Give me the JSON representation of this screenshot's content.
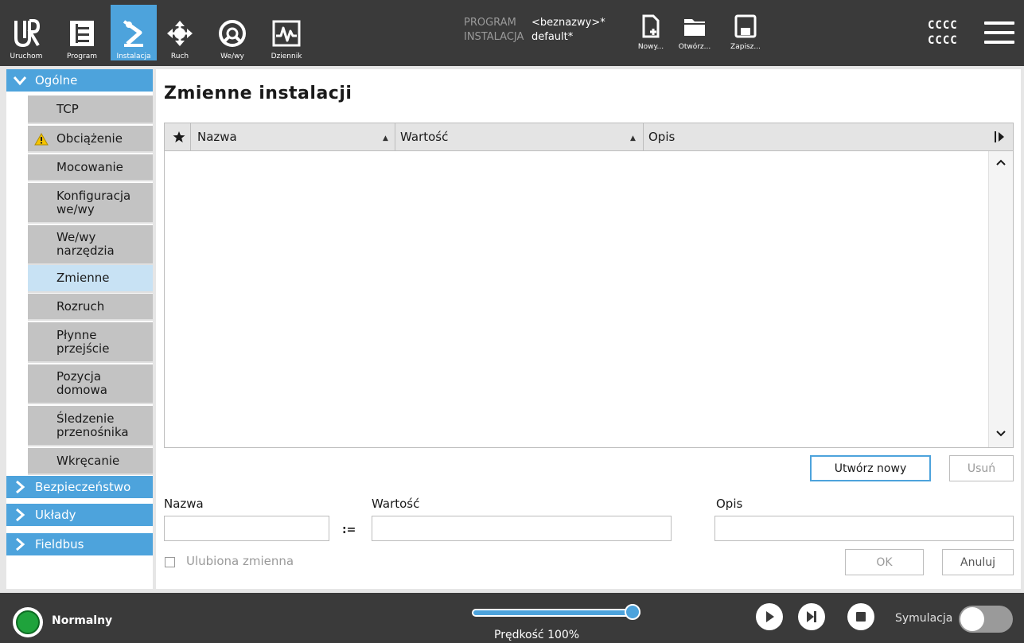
{
  "topbar": {
    "nav": [
      {
        "id": "run",
        "label": "Uruchom",
        "icon": "ur-logo-icon"
      },
      {
        "id": "program",
        "label": "Program",
        "icon": "program-tree-icon"
      },
      {
        "id": "installation",
        "label": "Instalacja",
        "icon": "robot-arm-icon",
        "active": true
      },
      {
        "id": "move",
        "label": "Ruch",
        "icon": "move-arrows-icon"
      },
      {
        "id": "io",
        "label": "We/wy",
        "icon": "io-icon"
      },
      {
        "id": "log",
        "label": "Dziennik",
        "icon": "log-chart-icon"
      }
    ],
    "program_key": "PROGRAM",
    "program_value": "<beznazwy>*",
    "installation_key": "INSTALACJA",
    "installation_value": "default*",
    "file_buttons": [
      {
        "id": "new",
        "label": "Nowy...",
        "icon": "new-file-icon"
      },
      {
        "id": "open",
        "label": "Otwórz...",
        "icon": "folder-icon"
      },
      {
        "id": "save",
        "label": "Zapisz...",
        "icon": "save-icon"
      }
    ],
    "user_line1": "CCCC",
    "user_line2": "CCCC",
    "menu_icon": "hamburger-menu-icon"
  },
  "sidebar": {
    "groups": [
      {
        "label": "Ogólne",
        "expanded": true
      },
      {
        "label": "Bezpieczeństwo",
        "expanded": false
      },
      {
        "label": "Układy",
        "expanded": false
      },
      {
        "label": "Fieldbus",
        "expanded": false
      }
    ],
    "items": [
      {
        "label": "TCP"
      },
      {
        "label": "Obciążenie",
        "warning": true
      },
      {
        "label": "Mocowanie"
      },
      {
        "label": "Konfiguracja we/wy"
      },
      {
        "label": "We/wy narzędzia"
      },
      {
        "label": "Zmienne",
        "selected": true
      },
      {
        "label": "Rozruch"
      },
      {
        "label": "Płynne przejście"
      },
      {
        "label": "Pozycja domowa"
      },
      {
        "label": "Śledzenie przenośnika"
      },
      {
        "label": "Wkręcanie"
      }
    ]
  },
  "main": {
    "title": "Zmienne instalacji",
    "table": {
      "columns": [
        "Nazwa",
        "Wartość",
        "Opis"
      ],
      "rows": []
    },
    "create_button": "Utwórz nowy",
    "delete_button": "Usuń",
    "form": {
      "name_label": "Nazwa",
      "name_value": "",
      "assign_operator": ":=",
      "value_label": "Wartość",
      "value_value": "",
      "desc_label": "Opis",
      "desc_value": "",
      "favorite_label": "Ulubiona zmienna",
      "favorite_checked": false
    },
    "ok_button": "OK",
    "cancel_button": "Anuluj"
  },
  "bottombar": {
    "status": "Normalny",
    "status_color": "#1fa33c",
    "speed_label": "Prędkość 100%",
    "speed_percent": 100,
    "simulation_label": "Symulacja",
    "simulation_on": false
  },
  "colors": {
    "accent": "#4da3dc",
    "topbar_bg": "#3a3a3a",
    "sidebar_item_bg": "#c3c3c3",
    "selected_item_bg": "#c8e2f4"
  }
}
